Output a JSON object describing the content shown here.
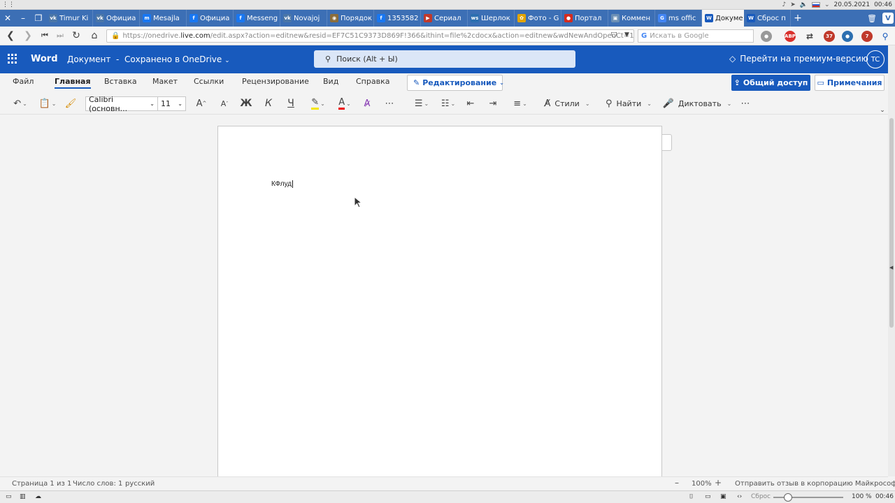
{
  "os": {
    "date": "20.05.2021",
    "time": "00:46"
  },
  "tabs": [
    {
      "label": "Timur Ki",
      "color": "#4a76a8",
      "fav": "vk"
    },
    {
      "label": "Официа",
      "color": "#4a76a8",
      "fav": "vk"
    },
    {
      "label": "Mesajla",
      "color": "#1877f2",
      "fav": "m"
    },
    {
      "label": "Официа",
      "color": "#1877f2",
      "fav": "f"
    },
    {
      "label": "Messeng",
      "color": "#1877f2",
      "fav": "f"
    },
    {
      "label": "Novajoj",
      "color": "#4a76a8",
      "fav": "vk"
    },
    {
      "label": "Порядок",
      "color": "#8a6d3b",
      "fav": "◉"
    },
    {
      "label": "1353582",
      "color": "#1877f2",
      "fav": "f"
    },
    {
      "label": "Сериал",
      "color": "#c0392b",
      "fav": "▶"
    },
    {
      "label": "Шерлок",
      "color": "#2c6fb0",
      "fav": "ws"
    },
    {
      "label": "Фото - G",
      "color": "#e2a400",
      "fav": "✿"
    },
    {
      "label": "Портал",
      "color": "#d52b1e",
      "fav": "●"
    },
    {
      "label": "Коммен",
      "color": "#6b8fb5",
      "fav": "▣"
    },
    {
      "label": "ms offic",
      "color": "#4285f4",
      "fav": "G"
    },
    {
      "label": "Докумен",
      "color": "#185abd",
      "fav": "W",
      "active": true
    },
    {
      "label": "Сброс п",
      "color": "#185abd",
      "fav": "W"
    }
  ],
  "address": {
    "url_prefix": "https://onedrive.",
    "url_host": "live.com",
    "url_rest": "/edit.aspx?action=editnew&resid=EF7C51C9373D869F!366&ithint=file%2cdocx&action=editnew&wdNewAndOpenCt=1...",
    "search_placeholder": "Искать в Google",
    "ext_badge_1": "37",
    "ext_badge_2": "7",
    "ext_abp": "ABP"
  },
  "word": {
    "app_name": "Word",
    "doc_title": "Документ",
    "save_status": "Сохранено в OneDrive",
    "search_placeholder": "Поиск (Alt + Ы)",
    "premium": "Перейти на премиум-версию",
    "avatar": "TC"
  },
  "ribbon": {
    "tabs": [
      "Файл",
      "Главная",
      "Вставка",
      "Макет",
      "Ссылки",
      "Рецензирование",
      "Вид",
      "Справка"
    ],
    "active_tab": "Главная",
    "edit_mode": "Редактирование",
    "share": "Общий доступ",
    "comments": "Примечания"
  },
  "toolbar": {
    "font_name": "Calibri (основн...",
    "font_size": "11",
    "bold": "Ж",
    "italic": "К",
    "underline": "Ч",
    "styles": "Стили",
    "find": "Найти",
    "dictate": "Диктовать"
  },
  "document": {
    "text": "КФлуд"
  },
  "status": {
    "page": "Страница 1 из 1",
    "words": "Число слов: 1",
    "language": "русский",
    "zoom": "100%",
    "feedback": "Отправить отзыв в корпорацию Майкрософт"
  },
  "browser_bottom": {
    "reset": "Сброс",
    "zoom": "100 %",
    "time": "00:46"
  },
  "colors": {
    "word_blue": "#185abd",
    "tabbar": "#3c6fb5"
  }
}
